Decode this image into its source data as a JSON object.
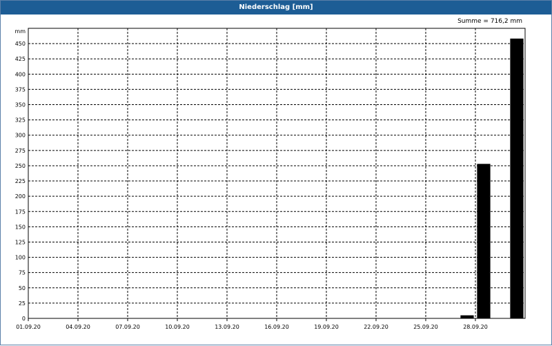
{
  "window": {
    "title": "Niederschlag [mm]"
  },
  "chart_data": {
    "type": "bar",
    "title": "Niederschlag [mm]",
    "summary": "Summe = 716,2 mm",
    "ylabel": "mm",
    "xlabel": "",
    "ylim": [
      0,
      475
    ],
    "yticks": [
      0,
      25,
      50,
      75,
      100,
      125,
      150,
      175,
      200,
      225,
      250,
      275,
      300,
      325,
      350,
      375,
      400,
      425,
      450
    ],
    "xticks": [
      "01.09.20",
      "04.09.20",
      "07.09.20",
      "10.09.20",
      "13.09.20",
      "16.09.20",
      "19.09.20",
      "22.09.20",
      "25.09.20",
      "28.09.20"
    ],
    "x_range": [
      "01.09.20",
      "30.09.20"
    ],
    "grid": true,
    "bar_color": "#000000",
    "series": [
      {
        "x": [
          "27.09.20",
          "28.09.20",
          "30.09.20"
        ],
        "values": [
          5.0,
          253.0,
          458.2
        ]
      }
    ]
  }
}
